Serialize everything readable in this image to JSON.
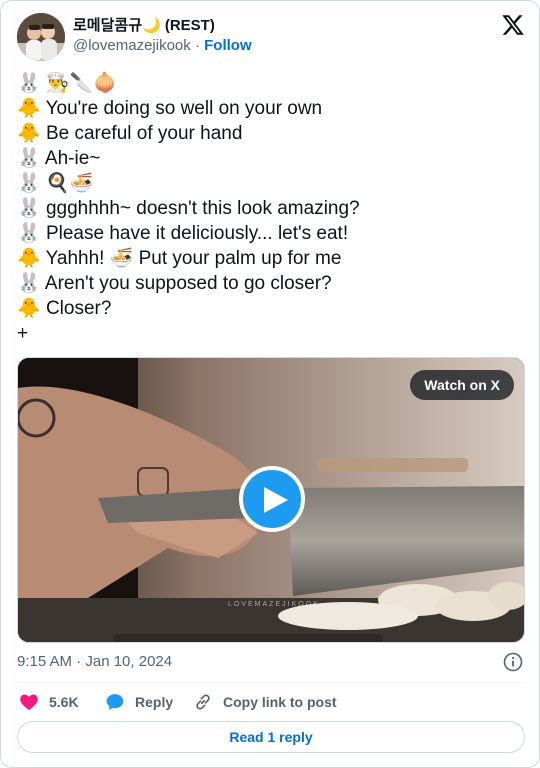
{
  "author": {
    "display_name": "로메달콤규🌙 (REST)",
    "handle": "@lovemazejikook",
    "separator": "·",
    "follow_label": "Follow"
  },
  "tweet": {
    "lines": [
      {
        "emojis": "🐰 👨‍🍳🔪🧅",
        "text": ""
      },
      {
        "emojis": "🐥",
        "text": "You're doing so well on your own"
      },
      {
        "emojis": "🐥",
        "text": "Be careful of your hand"
      },
      {
        "emojis": "🐰",
        "text": "Ah-ie~"
      },
      {
        "emojis": "🐰 🍳🍜",
        "text": ""
      },
      {
        "emojis": "🐰",
        "text": "ggghhhh~ doesn't this look amazing?"
      },
      {
        "emojis": "🐰",
        "text": "Please have it deliciously... let's eat!"
      },
      {
        "emojis": "🐥",
        "text": "Yahhh! 🍜 Put your palm up for me"
      },
      {
        "emojis": "🐰",
        "text": "Aren't you supposed to go closer?"
      },
      {
        "emojis": "🐥",
        "text": "Closer?"
      },
      {
        "emojis": "",
        "text": "+"
      }
    ]
  },
  "media": {
    "watch_label": "Watch on X",
    "watermark": "LOVEMAZEJIKOOK"
  },
  "meta": {
    "timestamp": "9:15 AM · Jan 10, 2024"
  },
  "actions": {
    "likes": "5.6K",
    "reply_label": "Reply",
    "copy_label": "Copy link to post"
  },
  "read_reply_label": "Read 1 reply",
  "colors": {
    "accent_blue": "#1d9bf0",
    "link_blue": "#006fd6",
    "like_pink": "#f91880",
    "text_secondary": "#536471"
  },
  "icons": {
    "brand": "x-logo-icon",
    "play": "play-icon",
    "info": "info-icon",
    "like": "heart-icon",
    "reply": "chat-bubble-icon",
    "copy": "link-icon"
  }
}
